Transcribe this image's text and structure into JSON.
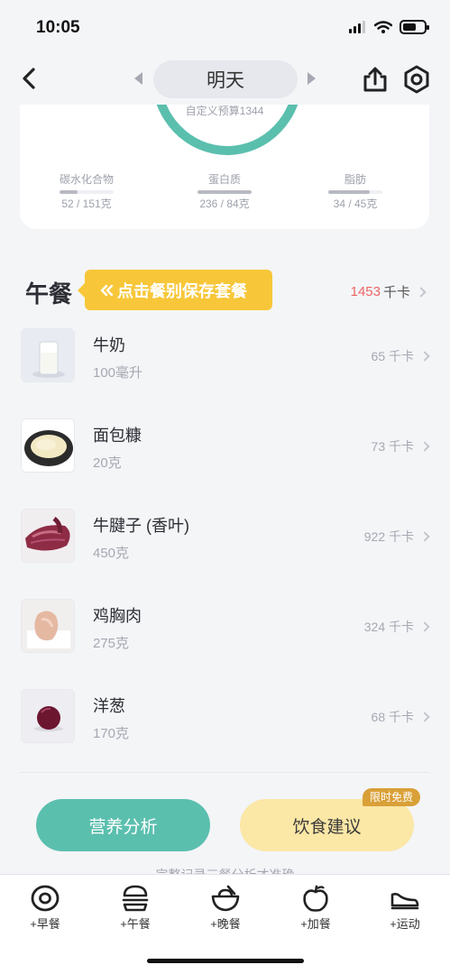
{
  "status": {
    "time": "10:05"
  },
  "nav": {
    "date": "明天"
  },
  "summary": {
    "budget_text": "自定义预算1344",
    "macros": [
      {
        "label": "碳水化合物",
        "value": "52 / 151克",
        "fill": 0.34
      },
      {
        "label": "蛋白质",
        "value": "236 / 84克",
        "fill": 1.0
      },
      {
        "label": "脂肪",
        "value": "34 / 45克",
        "fill": 0.76
      }
    ]
  },
  "meal": {
    "title": "午餐",
    "save_tip": "点击餐别保存套餐",
    "total_kcal": "1453",
    "kcal_unit": "千卡"
  },
  "foods": [
    {
      "name": "牛奶",
      "amount": "100毫升",
      "kcal": "65 千卡",
      "icon": "milk-glass"
    },
    {
      "name": "面包糠",
      "amount": "20克",
      "kcal": "73 千卡",
      "icon": "breadcrumbs-bowl"
    },
    {
      "name": "牛腱子 (香叶)",
      "amount": "450克",
      "kcal": "922 千卡",
      "icon": "beef-shank"
    },
    {
      "name": "鸡胸肉",
      "amount": "275克",
      "kcal": "324 千卡",
      "icon": "chicken-breast"
    },
    {
      "name": "洋葱",
      "amount": "170克",
      "kcal": "68 千卡",
      "icon": "onion"
    }
  ],
  "actions": {
    "analysis": "营养分析",
    "advice": "饮食建议",
    "free_badge": "限时免费",
    "cut_text": "完整记录三餐分析才准确"
  },
  "tabs": [
    {
      "label": "+早餐",
      "icon": "breakfast-icon"
    },
    {
      "label": "+午餐",
      "icon": "lunch-burger-icon"
    },
    {
      "label": "+晚餐",
      "icon": "dinner-bowl-icon"
    },
    {
      "label": "+加餐",
      "icon": "snack-apple-icon"
    },
    {
      "label": "+运动",
      "icon": "exercise-shoe-icon"
    }
  ],
  "colors": {
    "accent": "#5bbfae",
    "kcal": "#ef6464",
    "tip": "#f7c739",
    "advice": "#fbe7a6",
    "badge": "#d9a038"
  }
}
